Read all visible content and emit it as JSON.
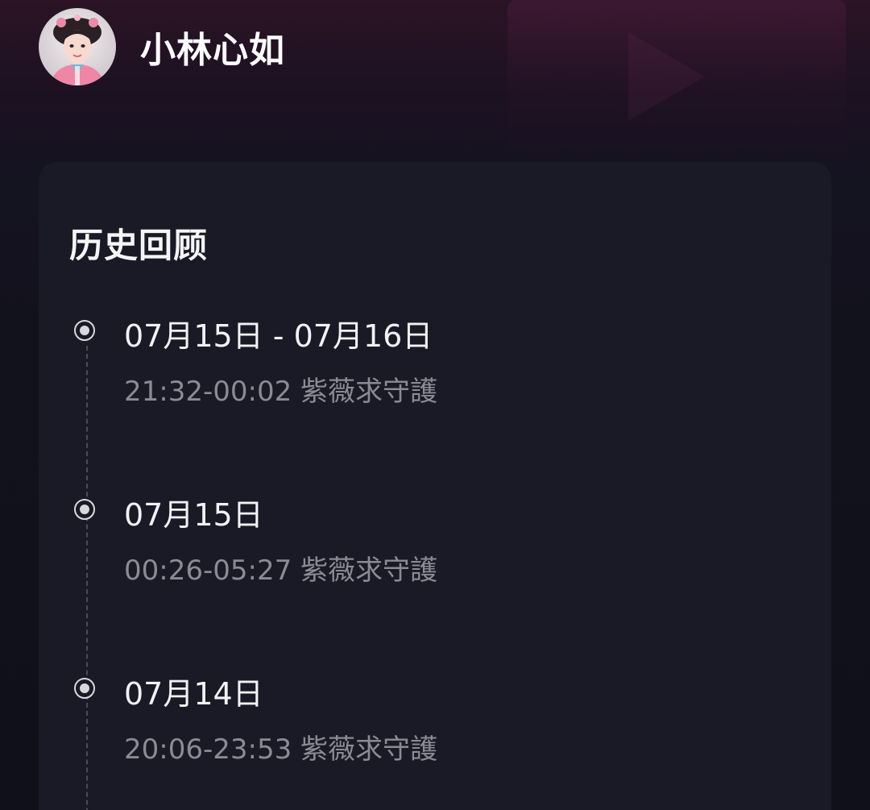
{
  "header": {
    "streamer_name": "小林心如"
  },
  "history": {
    "title": "历史回顾",
    "items": [
      {
        "date": "07月15日 - 07月16日",
        "time": "21:32-00:02",
        "show": "紫薇求守護"
      },
      {
        "date": "07月15日",
        "time": "00:26-05:27",
        "show": "紫薇求守護"
      },
      {
        "date": "07月14日",
        "time": "20:06-23:53",
        "show": "紫薇求守護"
      }
    ]
  },
  "colors": {
    "card_bg": "#191a25",
    "title_text": "#f2f2f5",
    "detail_text": "#8a8b94",
    "timeline_dot": "#d8d8dc"
  }
}
